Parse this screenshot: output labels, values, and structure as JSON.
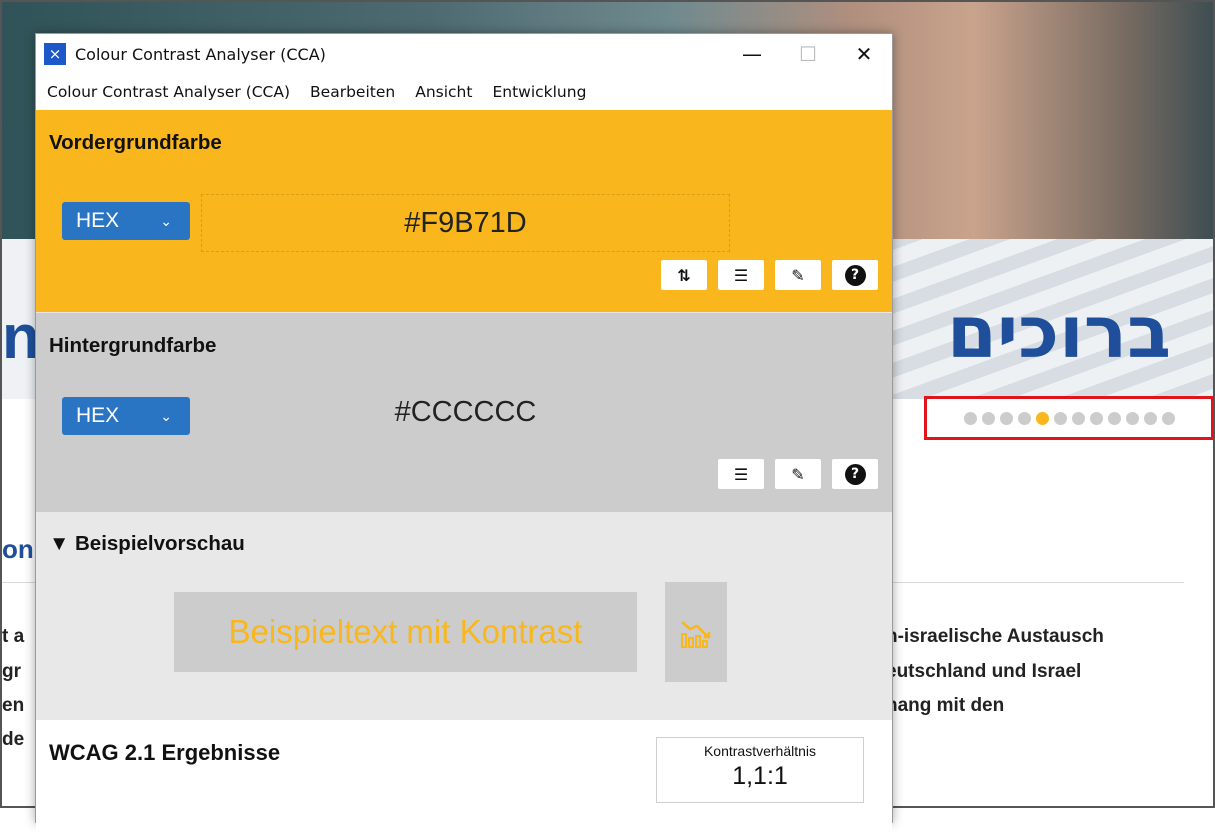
{
  "background_page": {
    "hebrew_banner": "ברוכים",
    "left_glyph": "n",
    "section_heading": "on",
    "right_lines": [
      "n-israelische Austausch",
      "eutschland und Israel",
      "hang mit den"
    ],
    "left_lines": [
      "t a",
      "gr",
      "en",
      "de"
    ],
    "carousel": {
      "dot_count": 12,
      "active_index": 4
    },
    "colors": {
      "highlight": "#e0151b",
      "active_dot": "#f9b71d",
      "dot": "#cccccc",
      "heading": "#1f4f9a"
    }
  },
  "window": {
    "title": "Colour Contrast Analyser (CCA)",
    "controls": {
      "minimize": "—",
      "maximize": "☐",
      "close": "✕"
    },
    "menu": [
      "Colour Contrast Analyser (CCA)",
      "Bearbeiten",
      "Ansicht",
      "Entwicklung"
    ]
  },
  "foreground": {
    "title": "Vordergrundfarbe",
    "format": "HEX",
    "value": "#F9B71D",
    "color": "#f9b71d",
    "tools": [
      "swap-icon",
      "sliders-icon",
      "eyedropper-icon",
      "help-icon"
    ]
  },
  "background": {
    "title": "Hintergrundfarbe",
    "format": "HEX",
    "value": "#CCCCCC",
    "color": "#cccccc",
    "tools": [
      "sliders-icon",
      "eyedropper-icon",
      "help-icon"
    ]
  },
  "preview": {
    "title": "Beispielvorschau",
    "toggle": "▼",
    "sample_text": "Beispieltext mit Kontrast",
    "graphic_icon": "chart-icon"
  },
  "results": {
    "title": "WCAG 2.1 Ergebnisse",
    "ratio_label": "Kontrastverhältnis",
    "ratio_value": "1,1:1"
  }
}
